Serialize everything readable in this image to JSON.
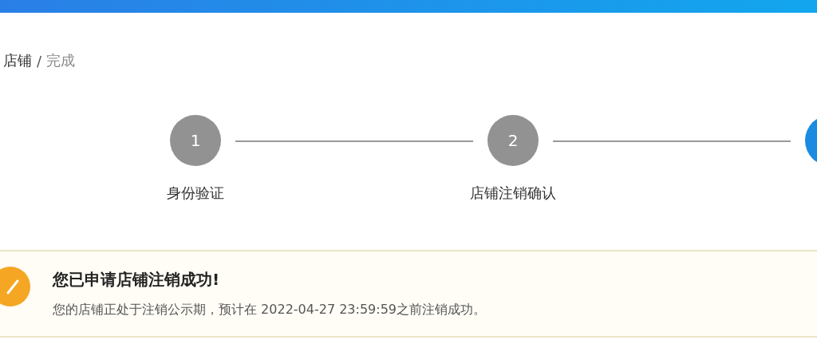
{
  "breadcrumb": [
    {
      "label": "店铺",
      "current": false
    },
    {
      "label": "完成",
      "current": true
    }
  ],
  "breadcrumb_separator": "/",
  "steps": [
    {
      "number": "1",
      "label": "身份验证",
      "current": false
    },
    {
      "number": "2",
      "label": "店铺注销确认",
      "current": false
    },
    {
      "current": true
    }
  ],
  "alert": {
    "kind": "success",
    "title": "您已申请店铺注销成功!",
    "message": "您的店铺正处于注销公示期，预计在 2022-04-27 23:59:59之前注销成功。"
  }
}
